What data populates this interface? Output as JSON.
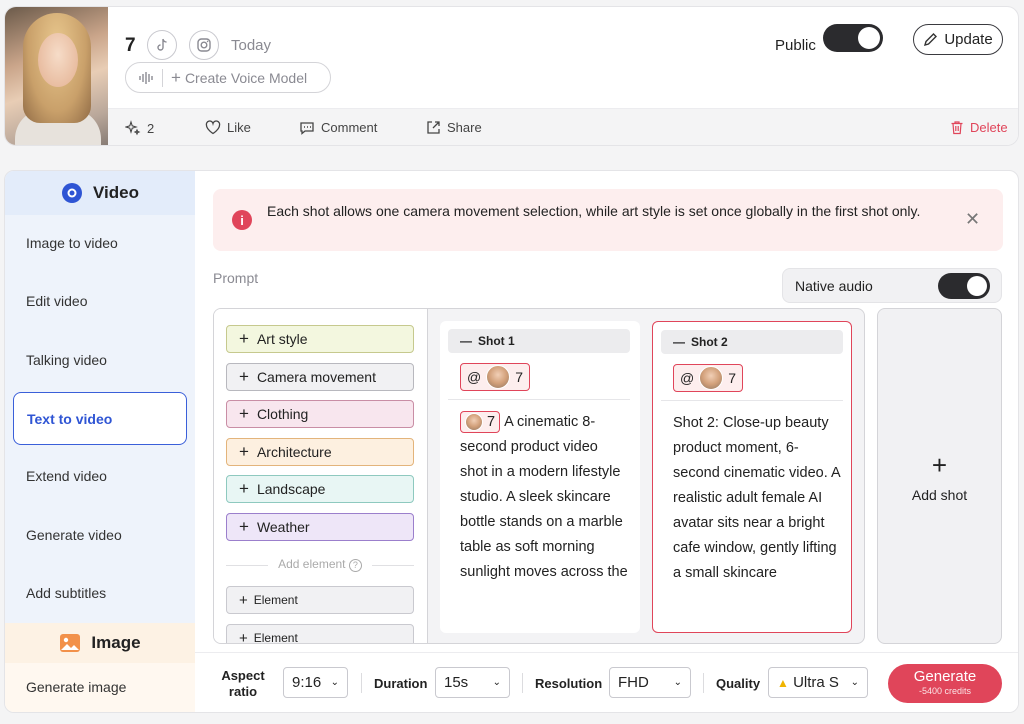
{
  "header": {
    "number": "7",
    "date": "Today",
    "voice_model_label": "Create Voice Model",
    "public_label": "Public",
    "public_on": true,
    "update_label": "Update",
    "actions": {
      "sparkle_count": "2",
      "like": "Like",
      "comment": "Comment",
      "share": "Share",
      "delete": "Delete"
    }
  },
  "sidebar": {
    "video_heading": "Video",
    "items": [
      "Image to video",
      "Edit video",
      "Talking video",
      "Text to video",
      "Extend video",
      "Generate video",
      "Add subtitles"
    ],
    "active_item": "Text to video",
    "image_heading": "Image",
    "image_item": "Generate image"
  },
  "alert": {
    "text": "Each shot allows one camera movement selection, while art style is set once globally in the first shot only."
  },
  "prompt_label": "Prompt",
  "native_audio": {
    "label": "Native audio",
    "on": true
  },
  "elements": {
    "tags": [
      {
        "label": "Art style",
        "color": "#f3f7df",
        "border": "#c6c98e"
      },
      {
        "label": "Camera movement",
        "color": "#f1f1f3",
        "border": "#b8b8be"
      },
      {
        "label": "Clothing",
        "color": "#f8e6ee",
        "border": "#c98ea5"
      },
      {
        "label": "Architecture",
        "color": "#fdf0e0",
        "border": "#e3b47b"
      },
      {
        "label": "Landscape",
        "color": "#e8f6f4",
        "border": "#8ec9bf"
      },
      {
        "label": "Weather",
        "color": "#eee6f8",
        "border": "#9b7fcc"
      }
    ],
    "add_element_label": "Add element",
    "element_label": "Element"
  },
  "shots": [
    {
      "title": "Shot 1",
      "ref_num": "7",
      "text": "A cinematic 8-second product video shot in a modern lifestyle studio. A sleek skincare bottle stands on a marble table as soft morning sunlight moves across the"
    },
    {
      "title": "Shot 2",
      "ref_num": "7",
      "text": "Shot 2: Close-up beauty product moment, 6-second cinematic video. A realistic adult female AI avatar sits near a bright cafe window, gently lifting a small skincare"
    }
  ],
  "add_shot_label": "Add shot",
  "settings": {
    "aspect_label": "Aspect ratio",
    "aspect_value": "9:16",
    "duration_label": "Duration",
    "duration_value": "15s",
    "resolution_label": "Resolution",
    "resolution_value": "FHD",
    "quality_label": "Quality",
    "quality_value": "Ultra S",
    "generate_label": "Generate",
    "credits": "-5400 credits"
  },
  "colors": {
    "accent": "#e0455a",
    "active_blue": "#2f55d4"
  }
}
